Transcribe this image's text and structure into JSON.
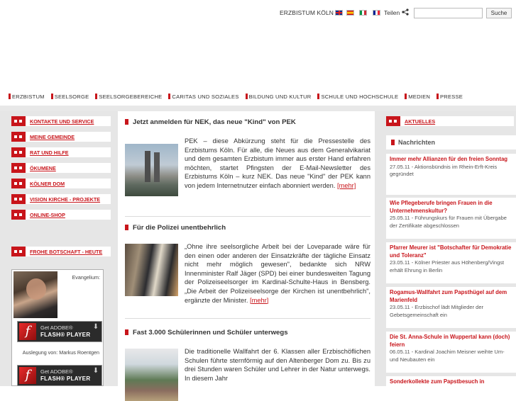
{
  "topbar": {
    "site_label": "ERZBISTUM KÖLN",
    "share_label": "Teilen",
    "search_placeholder": "",
    "search_button": "Suche",
    "languages": [
      "uk-flag",
      "spain-flag",
      "italy-flag",
      "france-flag"
    ]
  },
  "mainnav": {
    "items": [
      {
        "label": "ERZBISTUM"
      },
      {
        "label": "SEELSORGE"
      },
      {
        "label": "SEELSORGEBEREICHE"
      },
      {
        "label": "CARITAS UND SOZIALES"
      },
      {
        "label": "BILDUNG UND KULTUR"
      },
      {
        "label": "SCHULE UND HOCHSCHULE"
      },
      {
        "label": "MEDIEN"
      },
      {
        "label": "PRESSE"
      }
    ]
  },
  "leftnav": {
    "items": [
      {
        "label": "KONTAKTE UND SERVICE"
      },
      {
        "label": "MEINE GEMEINDE"
      },
      {
        "label": "RAT UND HILFE"
      },
      {
        "label": "ÖKUMENE"
      },
      {
        "label": "KÖLNER DOM"
      },
      {
        "label": "VISION KIRCHE - PROJEKTE"
      },
      {
        "label": "ONLINE-SHOP"
      }
    ],
    "frohe_botschaft": "FROHE BOTSCHAFT - HEUTE"
  },
  "gospel": {
    "evangelium_label": "Evangelium:",
    "flash_get": "Get ADOBE®",
    "flash_player": "FLASH® PLAYER",
    "author": "Auslegung von: Markus Roentgen"
  },
  "articles": [
    {
      "title": "Jetzt anmelden für NEK, das neue \"Kind\" von PEK",
      "text": "PEK – diese Abkürzung steht für die Pressestelle des Erzbistums Köln. Für alle, die Neues aus dem Generalvikariat und dem gesamten Erzbistum immer aus erster Hand erfahren möchten, startet Pfingsten der E-Mail-Newsletter des Erzbistums Köln – kurz NEK. Das neue \"Kind\" der PEK kann von jedem Internetnutzer einfach abonniert werden.",
      "more": "[mehr]"
    },
    {
      "title": "Für die Polizei unentbehrlich",
      "text": "„Ohne ihre seelsorgliche Arbeit bei der Loveparade wäre für den einen oder anderen der Einsatzkräfte der tägliche Einsatz nicht mehr möglich gewesen\", bedankte sich NRW Innenminister Ralf Jäger (SPD) bei einer bundesweiten Tagung der Polizeiseelsorger im Kardinal-Schulte-Haus in Bensberg. „Die Arbeit der Polizeiseelsorge der Kirchen ist unentbehrlich\", ergänzte der Minister.",
      "more": "[mehr]"
    },
    {
      "title": "Fast 3.000 Schülerinnen und Schüler unterwegs",
      "text": "Die traditionelle Wallfahrt der 6. Klassen aller Erzbischöflichen Schulen führte sternförmig auf den Altenberger Dom zu. Bis zu drei Stunden waren Schüler und Lehrer in der Natur unterwegs. In diesem Jahr",
      "more": ""
    }
  ],
  "rightcol": {
    "aktuelles": "AKTUELLES",
    "nachrichten": "Nachrichten",
    "news": [
      {
        "headline": "Immer mehr Allianzen für den freien Sonntag",
        "detail": "27.05.11 - Aktionsbündnis im Rhein-Erft-Kreis gegründet"
      },
      {
        "headline": "Wie Pflegeberufe bringen Frauen in die Unternehmenskultur?",
        "detail": "25.05.11 - Führungskurs für Frauen mit Übergabe der Zertifikate abgeschlossen"
      },
      {
        "headline": "Pfarrer Meurer ist \"Botschafter für Demokratie und Toleranz\"",
        "detail": "23.05.11 - Kölner Priester aus Höhenberg/Vingst erhält Ehrung in Berlin"
      },
      {
        "headline": "Rogamus-Wallfahrt zum Papsthügel auf dem Marienfeld",
        "detail": "23.05.11 - Erzbischof lädt Mitglieder der Gebetsgemeinschaft ein"
      },
      {
        "headline": "Die St. Anna-Schule in Wuppertal kann (doch) feiern",
        "detail": "06.05.11 - Kardinal Joachim Meisner weihte Um- und Neubauten ein"
      },
      {
        "headline": "Sonderkollekte zum Papstbesuch in",
        "detail": ""
      }
    ]
  },
  "colors": {
    "accent": "#c8151b",
    "sidebar_bg": "#e6e6e6"
  }
}
